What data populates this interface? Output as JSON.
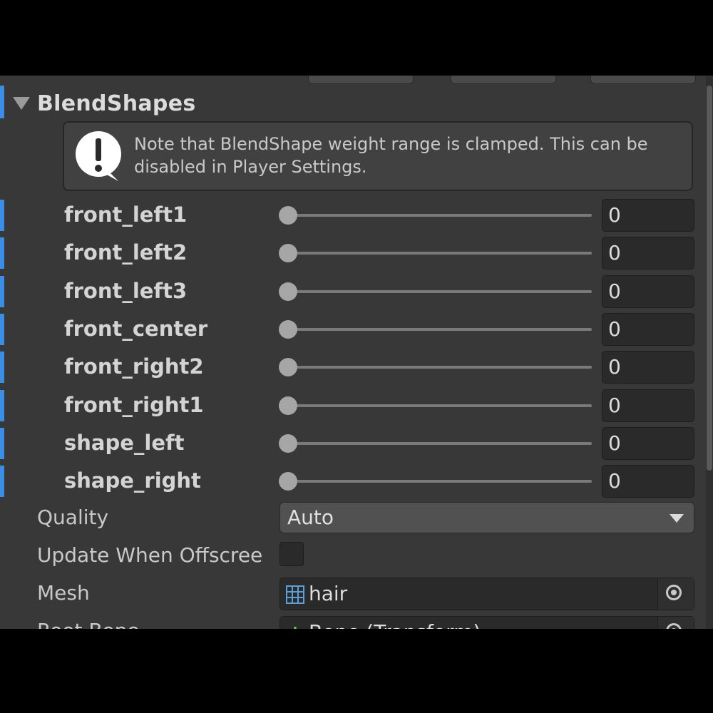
{
  "section": {
    "title": "BlendShapes",
    "helpbox_text": "Note that BlendShape weight range is clamped. This can be disabled in Player Settings.",
    "helpbox_icon": "warning-icon"
  },
  "blendshapes": [
    {
      "name": "front_left1",
      "value": "0",
      "slider_fraction": 0
    },
    {
      "name": "front_left2",
      "value": "0",
      "slider_fraction": 0
    },
    {
      "name": "front_left3",
      "value": "0",
      "slider_fraction": 0
    },
    {
      "name": "front_center",
      "value": "0",
      "slider_fraction": 0
    },
    {
      "name": "front_right2",
      "value": "0",
      "slider_fraction": 0
    },
    {
      "name": "front_right1",
      "value": "0",
      "slider_fraction": 0
    },
    {
      "name": "shape_left",
      "value": "0",
      "slider_fraction": 0
    },
    {
      "name": "shape_right",
      "value": "0",
      "slider_fraction": 0
    }
  ],
  "quality": {
    "label": "Quality",
    "value": "Auto"
  },
  "update_offscreen": {
    "label": "Update When Offscree",
    "checked": false
  },
  "mesh": {
    "label": "Mesh",
    "value": "hair",
    "icon": "mesh-icon"
  },
  "root_bone": {
    "label": "Root Bone",
    "value": "Bone (Transform)",
    "icon": "transform-icon"
  },
  "colors": {
    "accent": "#3a8ee6",
    "panel_bg": "#383838",
    "field_bg": "#2a2a2a"
  }
}
